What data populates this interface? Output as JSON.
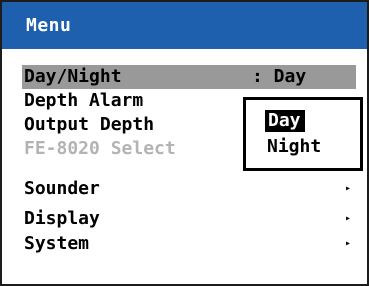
{
  "window": {
    "title": "Menu"
  },
  "menu": {
    "items": [
      {
        "label": "Day/Night",
        "value": ": Day",
        "selected": true,
        "disabled": false,
        "submenu": false
      },
      {
        "label": "Depth Alarm",
        "value": "",
        "selected": false,
        "disabled": false,
        "submenu": false
      },
      {
        "label": "Output Depth",
        "value": "",
        "selected": false,
        "disabled": false,
        "submenu": false
      },
      {
        "label": "FE-8020 Select",
        "value": "",
        "selected": false,
        "disabled": true,
        "submenu": false
      },
      {
        "label": "Sounder",
        "value": "",
        "selected": false,
        "disabled": false,
        "submenu": true
      },
      {
        "label": "Display",
        "value": "",
        "selected": false,
        "disabled": false,
        "submenu": true
      },
      {
        "label": "System",
        "value": "",
        "selected": false,
        "disabled": false,
        "submenu": true
      }
    ]
  },
  "popup": {
    "options": [
      {
        "label": "Day",
        "highlighted": true
      },
      {
        "label": "Night",
        "highlighted": false
      }
    ]
  },
  "icons": {
    "submenu_arrow": "triangle-right-icon",
    "submenu_glyph": "▸"
  },
  "colors": {
    "title_bar": "#1e5fae",
    "title_text": "#ffffff",
    "selection_bg": "#999999",
    "disabled_text": "#b3b3b3",
    "popup_highlight_bg": "#000000",
    "popup_highlight_text": "#ffffff"
  }
}
